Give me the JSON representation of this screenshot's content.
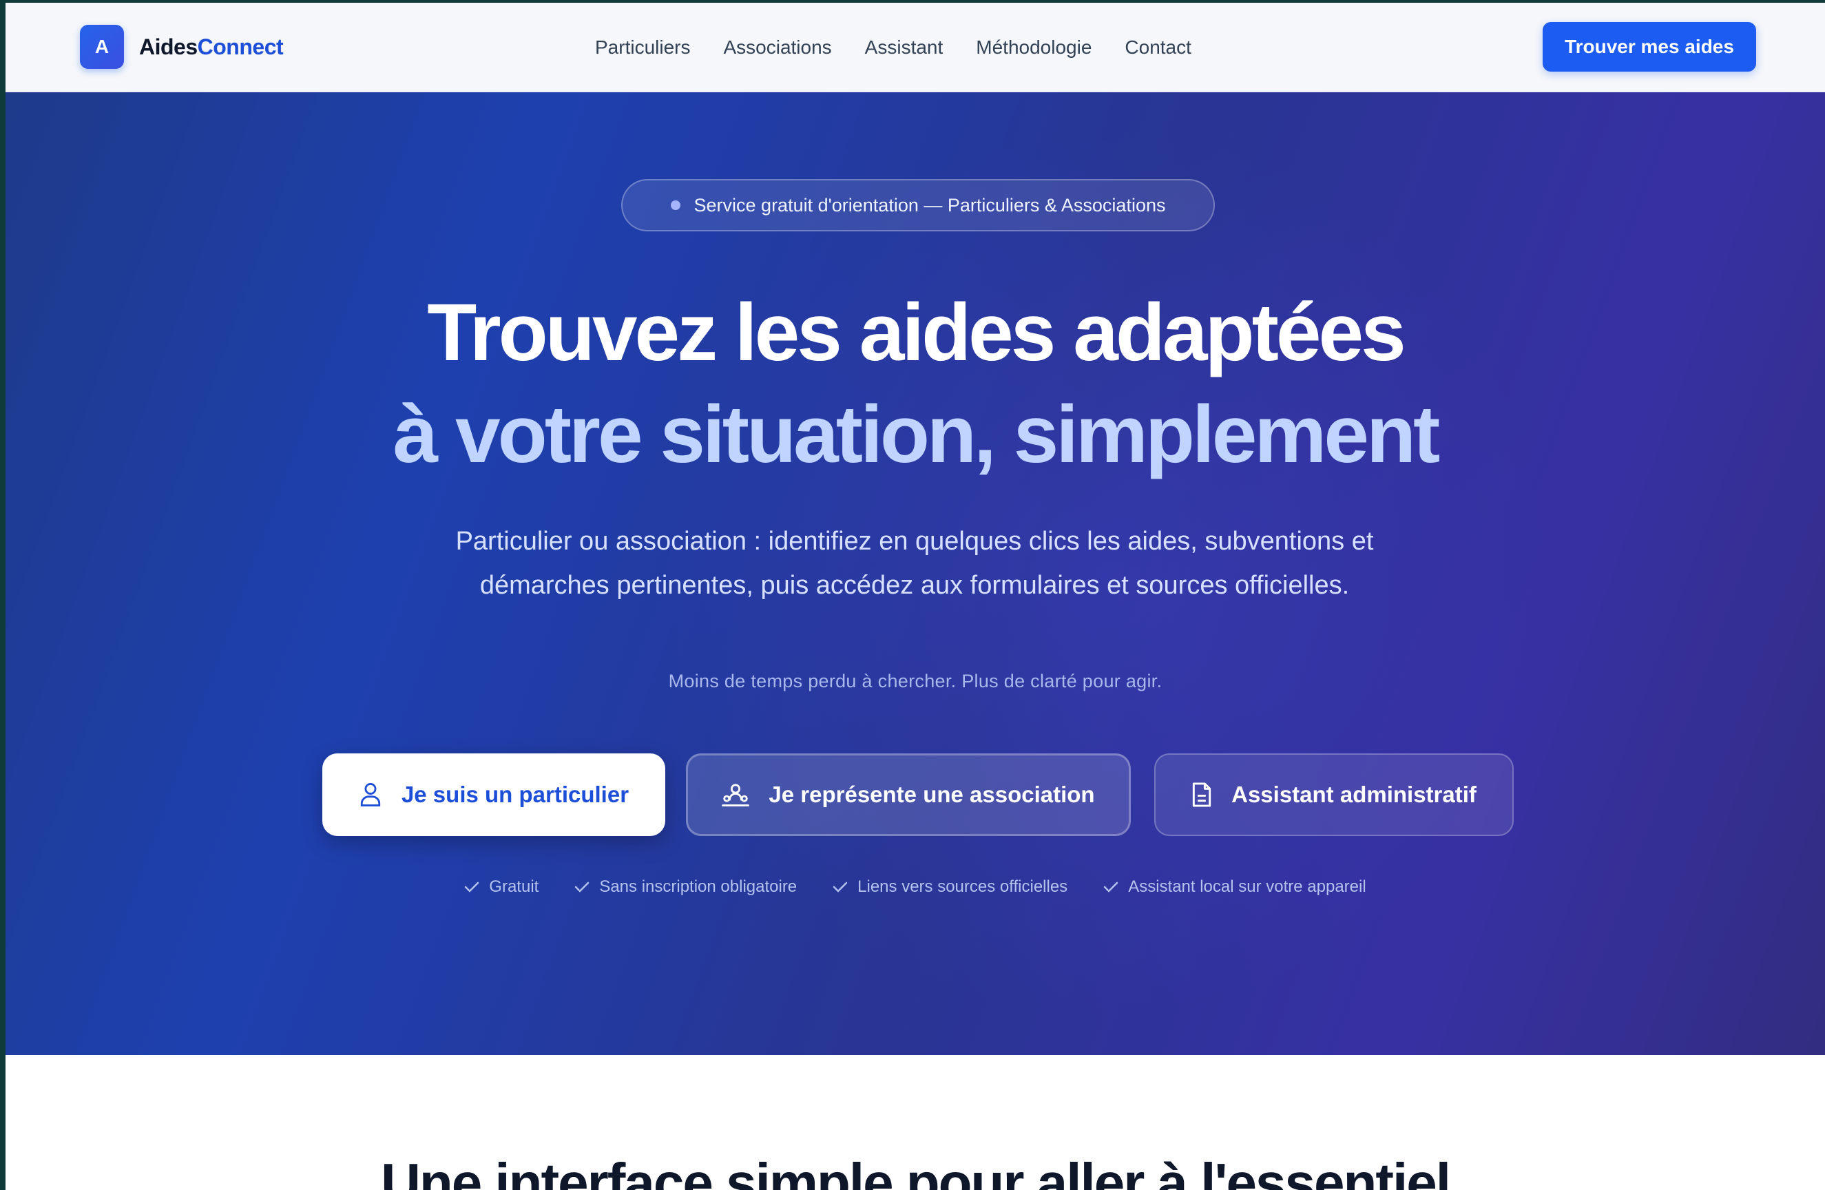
{
  "brand": {
    "mark": "A",
    "name_part1": "Aides",
    "name_part2": "Connect"
  },
  "nav": {
    "links": [
      "Particuliers",
      "Associations",
      "Assistant",
      "Méthodologie",
      "Contact"
    ],
    "cta": "Trouver mes aides"
  },
  "hero": {
    "pill": "Service gratuit d'orientation — Particuliers & Associations",
    "title_line1": "Trouvez les aides adaptées",
    "title_line2": "à votre situation, simplement",
    "subtitle": "Particulier ou association : identifiez en quelques clics les aides, subventions et démarches pertinentes, puis accédez aux formulaires et sources officielles.",
    "tagline": "Moins de temps perdu à chercher. Plus de clarté pour agir.",
    "buttons": [
      {
        "label": "Je suis un particulier",
        "icon": "user-icon"
      },
      {
        "label": "Je représente une association",
        "icon": "group-icon"
      },
      {
        "label": "Assistant administratif",
        "icon": "document-icon"
      }
    ],
    "checks": [
      "Gratuit",
      "Sans inscription obligatoire",
      "Liens vers sources officielles",
      "Assistant local sur votre appareil"
    ]
  },
  "section2": {
    "title": "Une interface simple pour aller à l'essentiel"
  },
  "colors": {
    "primary": "#1d5cf0",
    "hero_start": "#1e3a8a",
    "hero_end": "#312e81",
    "accent_light": "#bfd4ff"
  }
}
